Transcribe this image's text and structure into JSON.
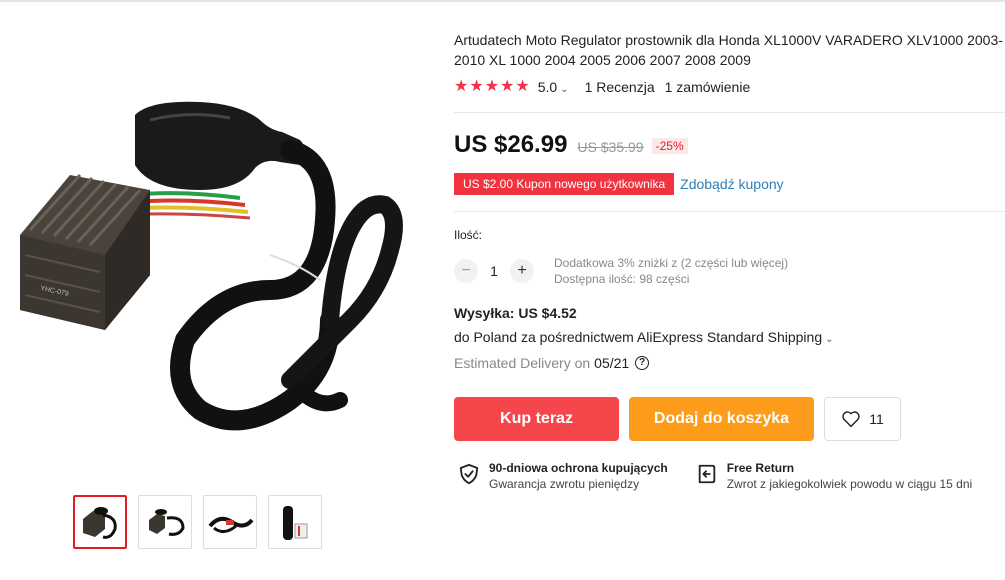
{
  "product": {
    "title": "Artudatech Moto Regulator prostownik dla Honda XL1000V VARADERO XLV1000 2003-2010 XL 1000 2004 2005 2006 2007 2008 2009",
    "rating_value": "5.0",
    "rating_stars": 5,
    "reviews": "1 Recenzja",
    "orders": "1 zamówienie"
  },
  "price": {
    "current": "US $26.99",
    "old": "US $35.99",
    "discount": "-25%"
  },
  "coupon": {
    "badge": "US $2.00 Kupon nowego użytkownika",
    "link": "Zdobądź kupony"
  },
  "quantity": {
    "label": "Ilość:",
    "value": "1",
    "minus": "−",
    "plus": "+",
    "extra_discount": "Dodatkowa 3% zniżki z (2 części lub więcej)",
    "available": "Dostępna ilość: 98 części"
  },
  "shipping": {
    "title": "Wysyłka: US $4.52",
    "description": "do Poland za pośrednictwem AliExpress Standard Shipping",
    "estimated_label": "Estimated Delivery on",
    "estimated_date": "05/21",
    "help": "?"
  },
  "actions": {
    "buy_now": "Kup teraz",
    "add_to_cart": "Dodaj do koszyka",
    "wishlist_count": "11"
  },
  "guarantees": [
    {
      "title": "90-dniowa ochrona kupujących",
      "subtitle": "Gwarancja zwrotu pieniędzy",
      "icon": "shield-check-icon"
    },
    {
      "title": "Free Return",
      "subtitle": "Zwrot z jakiegokolwiek powodu w ciągu 15 dni",
      "icon": "return-box-icon"
    }
  ],
  "gallery": {
    "thumbnail_count": 4,
    "active_index": 0
  },
  "colors": {
    "accent_red": "#f5474b",
    "accent_orange": "#fd9c1b",
    "star": "#f5324a",
    "link_blue": "#2e7fb8"
  }
}
